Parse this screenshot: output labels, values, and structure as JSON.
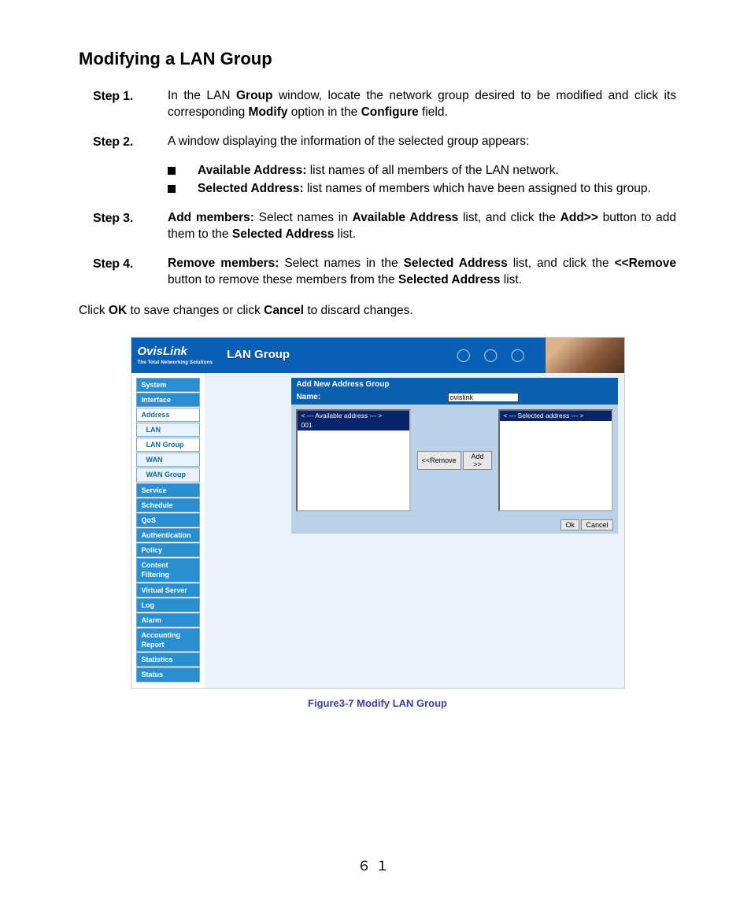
{
  "page": {
    "title": "Modifying a LAN Group",
    "number": "６１"
  },
  "steps": {
    "s1": {
      "label": "Step 1.",
      "pre": "In the LAN ",
      "b1": "Group",
      "mid1": " window, locate the network group desired to be modified and click its corresponding ",
      "b2": "Modify",
      "mid2": " option in the ",
      "b3": "Configure",
      "end": " field."
    },
    "s2": {
      "label": "Step 2.",
      "text": "A window displaying the information of the selected group appears:"
    },
    "bullet1": {
      "b": "Available Address:",
      "rest": " list names of all members of the LAN network."
    },
    "bullet2": {
      "b": "Selected Address:",
      "rest": " list names of members which have been assigned to this group."
    },
    "s3": {
      "label": "Step 3.",
      "b1": "Add members:",
      "mid1": " Select names in ",
      "b2": "Available Address",
      "mid2": " list, and click the ",
      "b3": "Add>>",
      "mid3": " button to add them to the ",
      "b4": "Selected Address",
      "end": " list."
    },
    "s4": {
      "label": "Step 4.",
      "b1": "Remove members:",
      "mid1": " Select names in the ",
      "b2": "Selected Address",
      "mid2": " list, and click the ",
      "b3": "<<Remove",
      "mid3": " button to remove these members from the ",
      "b4": "Selected Address",
      "end": " list."
    }
  },
  "outro": {
    "pre": "Click ",
    "b1": "OK",
    "mid": " to save changes or click ",
    "b2": "Cancel",
    "end": " to discard changes."
  },
  "shot": {
    "logo_name": "OvisLink",
    "logo_tag": "The Total Networking Solutions",
    "page_title": "LAN Group",
    "nav": {
      "top": [
        "System",
        "Interface",
        "Address"
      ],
      "subs": [
        "LAN",
        "LAN Group",
        "WAN",
        "WAN Group"
      ],
      "rest": [
        "Service",
        "Schedule",
        "QoS",
        "Authentication",
        "Policy",
        "Content Filtering",
        "Virtual Server",
        "Log",
        "Alarm",
        "Accounting Report",
        "Statistics",
        "Status"
      ]
    },
    "panel": {
      "title": "Add New Address Group",
      "name_label": "Name:",
      "name_value": "ovislink",
      "avail_hdr": "< --- Available address --- >",
      "avail_row": "001",
      "sel_hdr": "< --- Selected address --- >",
      "btn_remove": "<<Remove",
      "btn_add": "Add  >>",
      "btn_ok": "Ok",
      "btn_cancel": "Cancel"
    }
  },
  "caption": "Figure3-7 Modify LAN Group"
}
